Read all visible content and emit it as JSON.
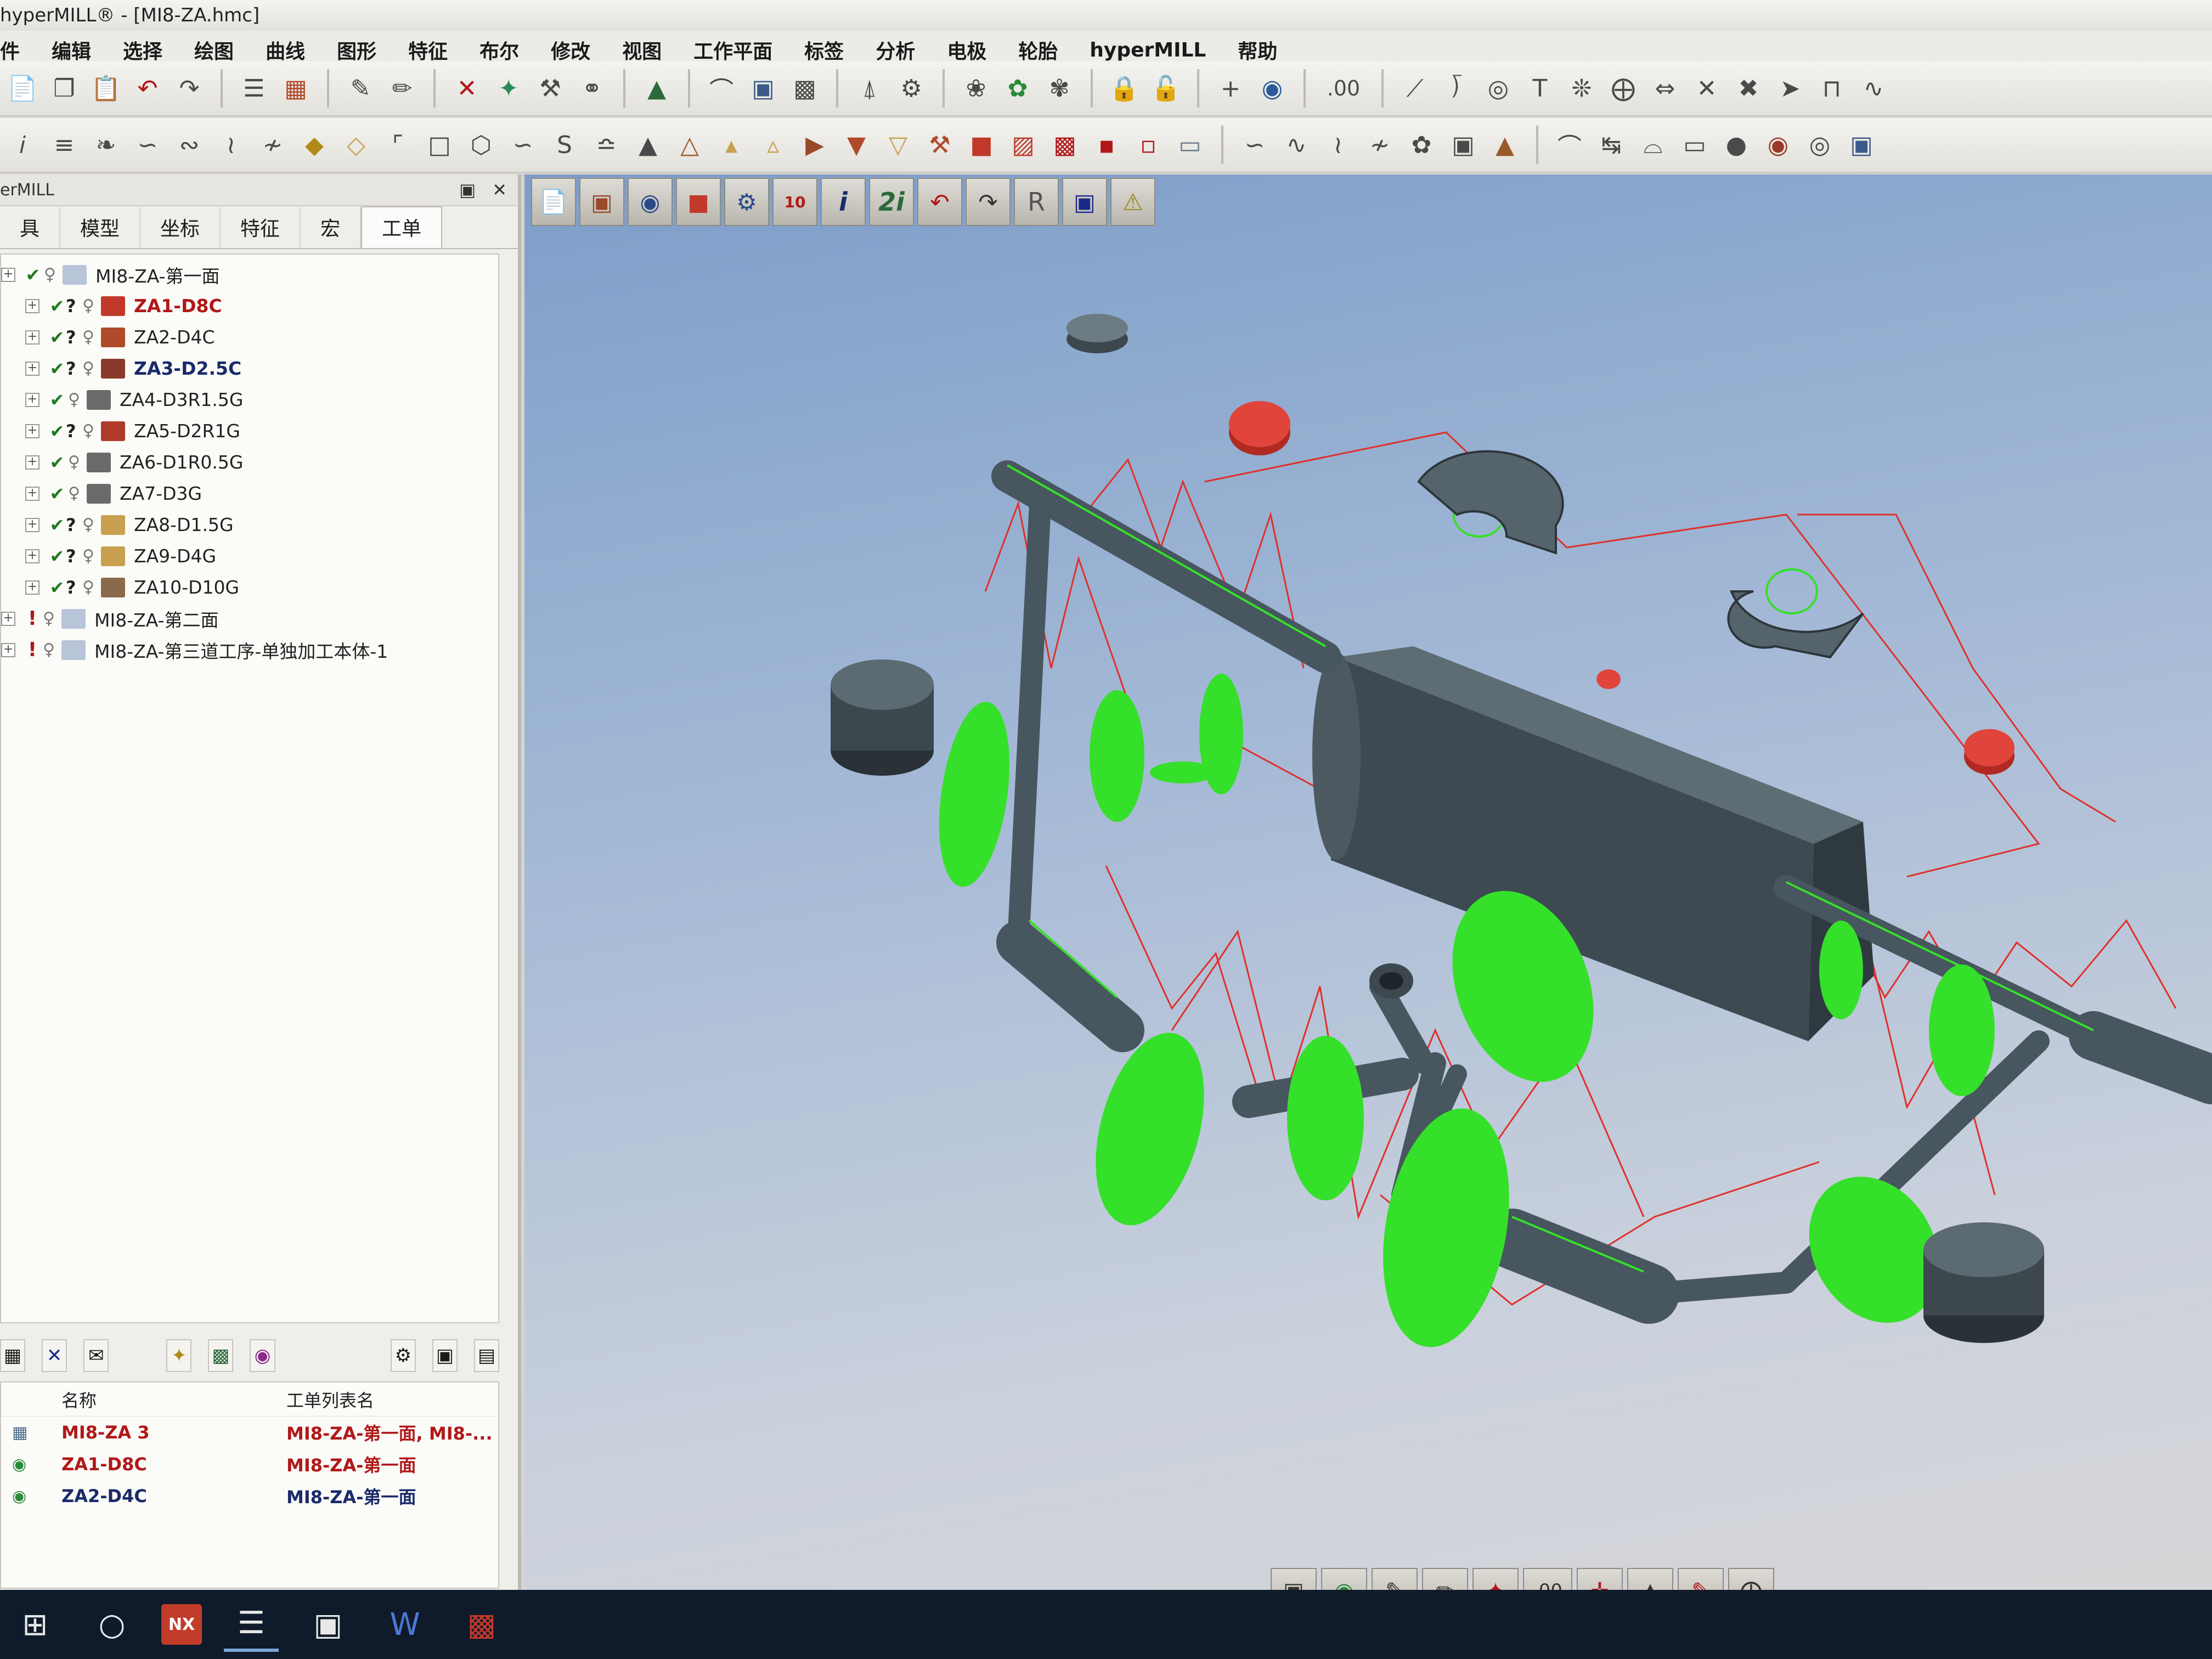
{
  "window": {
    "title": "hyperMILL® - [MI8-ZA.hmc]"
  },
  "menu": [
    "件",
    "编辑",
    "选择",
    "绘图",
    "曲线",
    "图形",
    "特征",
    "布尔",
    "修改",
    "视图",
    "工作平面",
    "标签",
    "分析",
    "电极",
    "轮胎",
    "hyperMILL",
    "帮助"
  ],
  "panel": {
    "title": "erMILL",
    "tabs": [
      "具",
      "模型",
      "坐标",
      "特征",
      "宏",
      "工单"
    ],
    "active_tab": "工单",
    "tree": [
      {
        "label": "MI8-ZA-第一面",
        "level": 0,
        "status": "check",
        "style": "normal",
        "color": "#b8c4d8"
      },
      {
        "label": "ZA1-D8C",
        "level": 1,
        "status": "check-q",
        "style": "red",
        "color": "#c0392b"
      },
      {
        "label": "ZA2-D4C",
        "level": 1,
        "status": "check-q",
        "style": "normal",
        "color": "#b04a2a"
      },
      {
        "label": "ZA3-D2.5C",
        "level": 1,
        "status": "check-q",
        "style": "dark",
        "color": "#8a3a2a"
      },
      {
        "label": "ZA4-D3R1.5G",
        "level": 1,
        "status": "check",
        "style": "normal",
        "color": "#6a6a6a"
      },
      {
        "label": "ZA5-D2R1G",
        "level": 1,
        "status": "check-q",
        "style": "normal",
        "color": "#b03a2a"
      },
      {
        "label": "ZA6-D1R0.5G",
        "level": 1,
        "status": "check",
        "style": "normal",
        "color": "#6a6a6a"
      },
      {
        "label": "ZA7-D3G",
        "level": 1,
        "status": "check",
        "style": "normal",
        "color": "#6a6a6a"
      },
      {
        "label": "ZA8-D1.5G",
        "level": 1,
        "status": "check-q",
        "style": "normal",
        "color": "#c8a050"
      },
      {
        "label": "ZA9-D4G",
        "level": 1,
        "status": "check-q",
        "style": "normal",
        "color": "#c8a050"
      },
      {
        "label": "ZA10-D10G",
        "level": 1,
        "status": "check-q",
        "style": "normal",
        "color": "#8a6a4a"
      },
      {
        "label": "MI8-ZA-第二面",
        "level": 0,
        "status": "excl",
        "style": "normal",
        "color": "#b8c4d8"
      },
      {
        "label": "MI8-ZA-第三道工序-单独加工本体-1",
        "level": 0,
        "status": "excl",
        "style": "normal",
        "color": "#b8c4d8"
      }
    ],
    "list": {
      "headers": [
        "名称",
        "工单列表名"
      ],
      "rows": [
        {
          "name": "MI8-ZA 3",
          "joblist": "MI8-ZA-第一面, MI8-...",
          "style": "red"
        },
        {
          "name": "ZA1-D8C",
          "joblist": "MI8-ZA-第一面",
          "style": "red"
        },
        {
          "name": "ZA2-D4C",
          "joblist": "MI8-ZA-第一面",
          "style": "blue"
        }
      ]
    }
  },
  "viewport": {
    "toolbar_num": "10",
    "toolbar_it1": "i",
    "toolbar_it2": "2i",
    "toolbar_r": "R",
    "bottom_value": ".00"
  },
  "toolbar": {
    "value_readout": ".00"
  },
  "taskbar": {
    "nx": "NX"
  },
  "colors": {
    "toolpath": "#35e02a",
    "rapid": "#e0302a",
    "model": "#4b5a64",
    "marker": "#e0443a"
  }
}
